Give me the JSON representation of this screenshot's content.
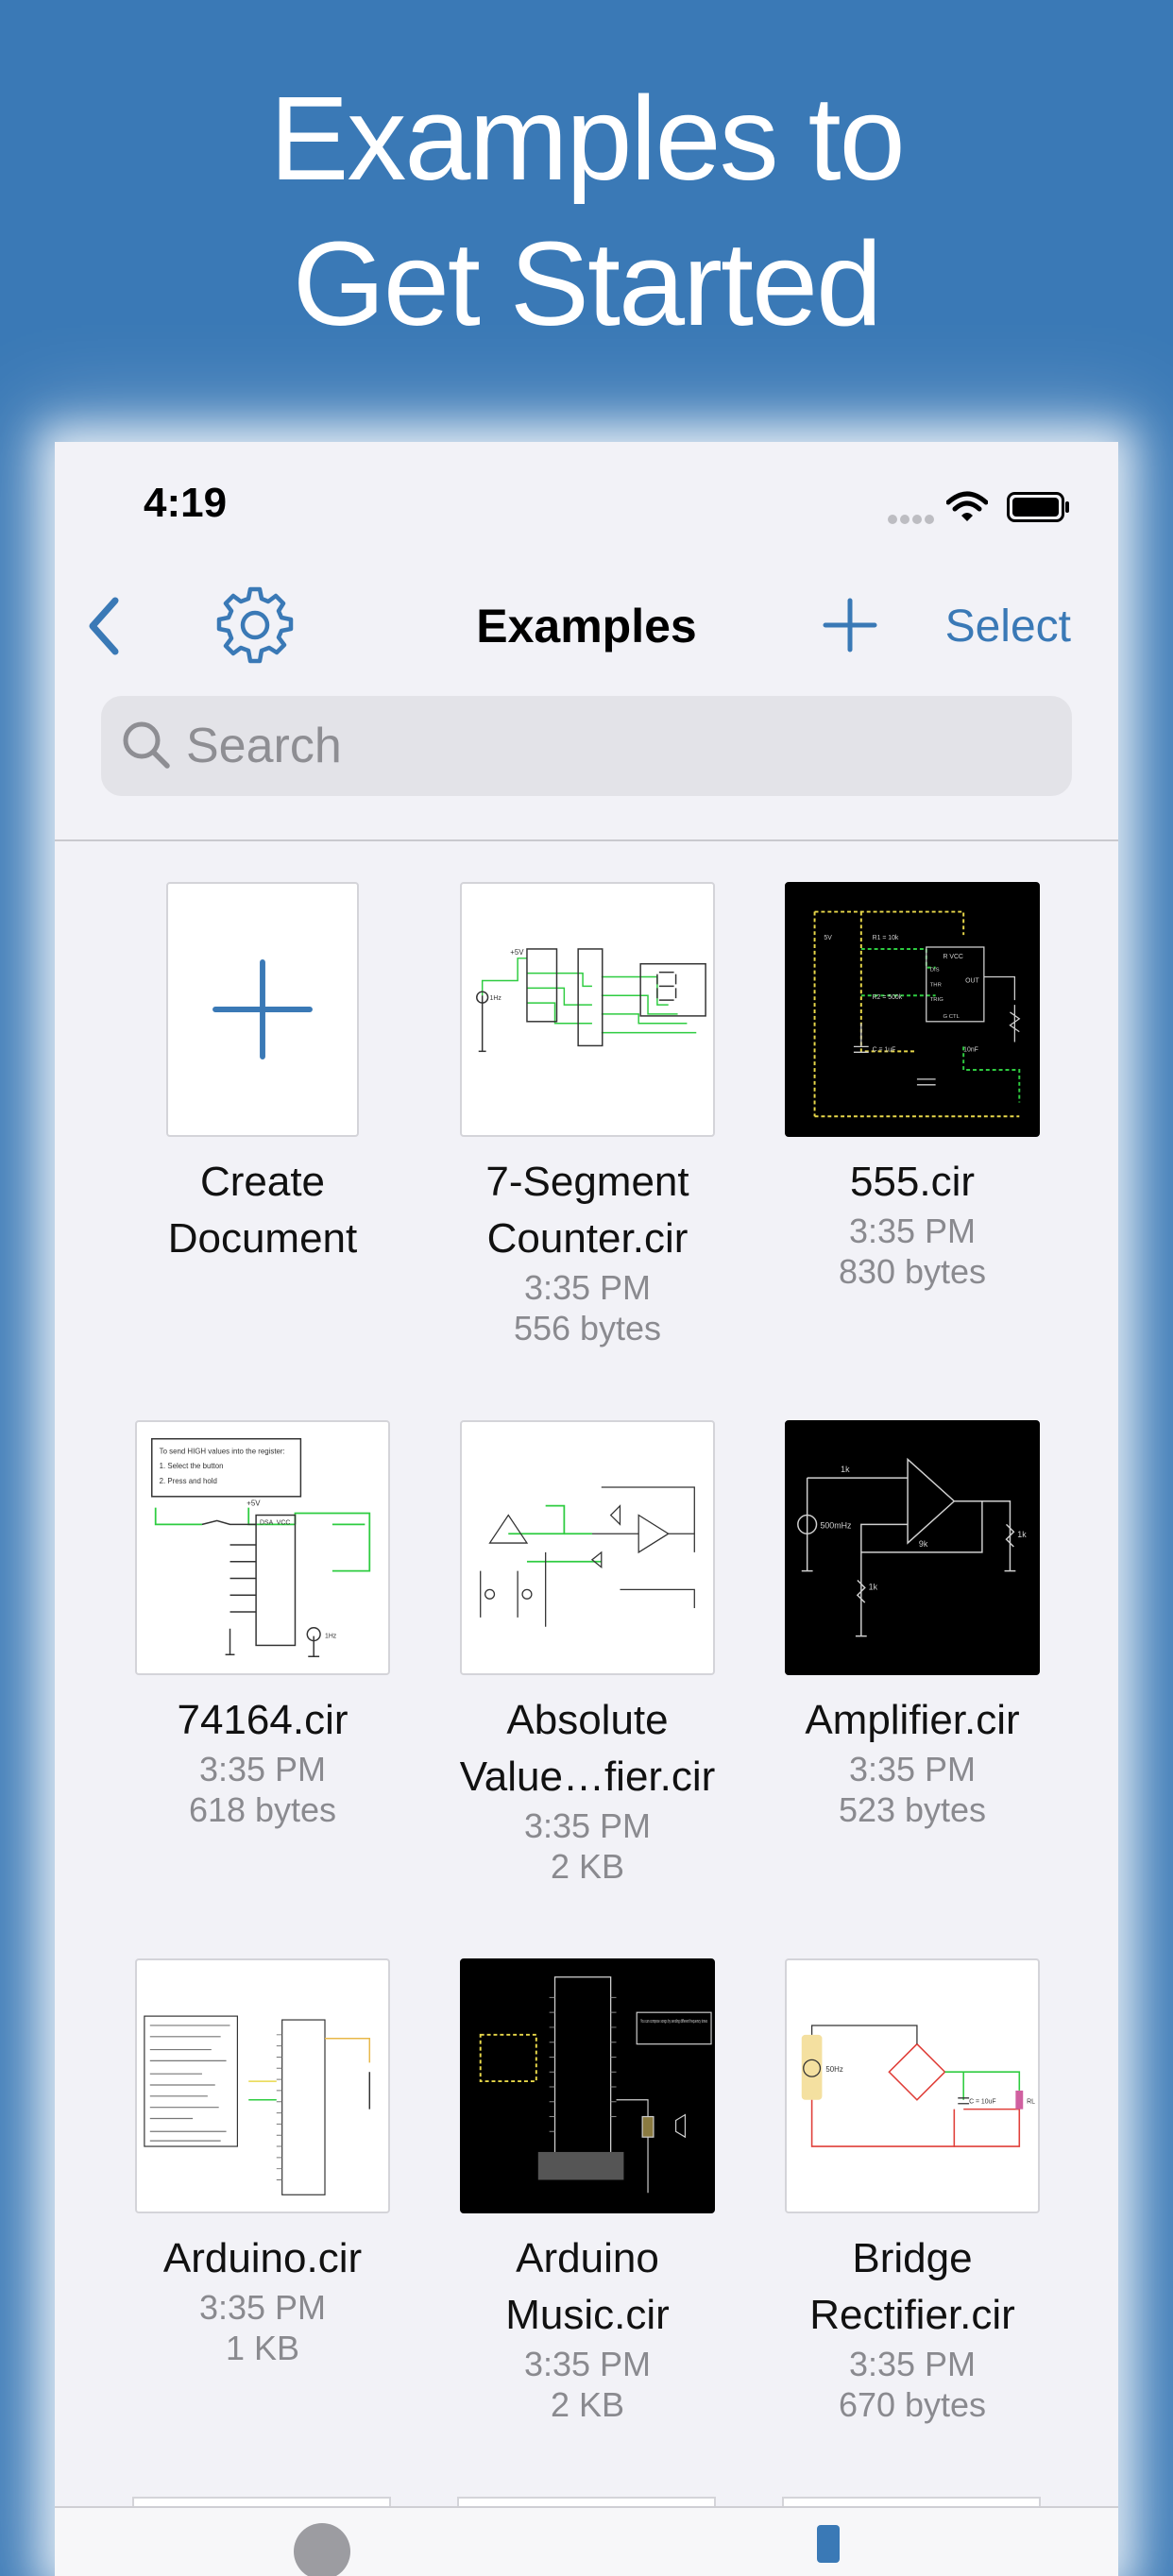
{
  "promo": {
    "line1": "Examples to",
    "line2": "Get Started"
  },
  "status_bar": {
    "time": "4:19"
  },
  "nav": {
    "title": "Examples",
    "select_label": "Select"
  },
  "search": {
    "placeholder": "Search"
  },
  "documents": [
    {
      "name_line1": "Create",
      "name_line2": "Document",
      "time": "",
      "size": ""
    },
    {
      "name_line1": "7-Segment",
      "name_line2": "Counter.cir",
      "time": "3:35 PM",
      "size": "556 bytes"
    },
    {
      "name_line1": "555.cir",
      "name_line2": "",
      "time": "3:35 PM",
      "size": "830 bytes"
    },
    {
      "name_line1": "74164.cir",
      "name_line2": "",
      "time": "3:35 PM",
      "size": "618 bytes"
    },
    {
      "name_line1": "Absolute",
      "name_line2": "Value…fier.cir",
      "time": "3:35 PM",
      "size": "2 KB"
    },
    {
      "name_line1": "Amplifier.cir",
      "name_line2": "",
      "time": "3:35 PM",
      "size": "523 bytes"
    },
    {
      "name_line1": "Arduino.cir",
      "name_line2": "",
      "time": "3:35 PM",
      "size": "1 KB"
    },
    {
      "name_line1": "Arduino",
      "name_line2": "Music.cir",
      "time": "3:35 PM",
      "size": "2 KB"
    },
    {
      "name_line1": "Bridge",
      "name_line2": "Rectifier.cir",
      "time": "3:35 PM",
      "size": "670 bytes"
    }
  ],
  "thumbnail_text": {
    "seven_seg_supply": "+5V",
    "seven_seg_clock": "1Hz",
    "t555_supply": "5V",
    "t555_r1": "R1 = 10k",
    "t555_r2": "R2 = 500k",
    "t555_c": "C = 1uF",
    "t555_c2": "10nF",
    "t555_vcc": "R VCC",
    "t555_dis": "DIS",
    "t555_thr": "THR",
    "t555_trg": "TRIG",
    "t555_out": "OUT",
    "t555_ctl": "G CTL",
    "s74164_note1": "To send HIGH values into the register:",
    "s74164_note2": "1. Select the button",
    "s74164_note3": "2. Press and hold",
    "s74164_supply": "+5V",
    "s74164_dsa": "DSA",
    "s74164_vcc": "VCC",
    "s74164_clock": "1Hz",
    "amp_r1": "1k",
    "amp_source": "500mHz",
    "amp_r2": "9k",
    "amp_r3": "1k",
    "amp_r4": "1k",
    "music_note": "You can compose songs by sending different frequency tones",
    "bridge_source": "50Hz",
    "bridge_cap": "C = 10uF",
    "bridge_load": "RL"
  },
  "colors": {
    "background": "#3a79b6",
    "accent": "#3a79b6",
    "wire_green": "#2ecc40",
    "wire_yellow": "#e8d84a",
    "wire_red": "#e0403a"
  },
  "icons": [
    "back-chevron-icon",
    "gear-icon",
    "plus-icon",
    "search-icon",
    "wifi-icon",
    "battery-icon",
    "signal-icon"
  ]
}
